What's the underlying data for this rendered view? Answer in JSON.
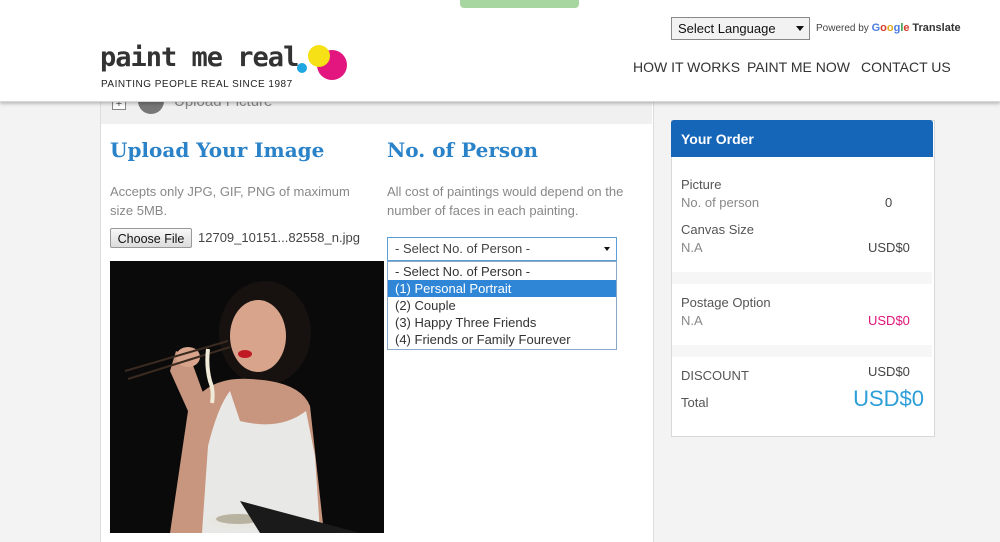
{
  "header": {
    "logo_text": "paint me real",
    "tagline": "PAINTING PEOPLE REAL SINCE 1987",
    "language_select": "Select Language",
    "powered_by": "Powered by",
    "google": "Google",
    "translate": "Translate",
    "nav": [
      "HOW IT WORKS",
      "PAINT ME NOW",
      "CONTACT US"
    ]
  },
  "step": {
    "plus": "+",
    "label": "Upload Picture"
  },
  "upload": {
    "title": "Upload Your Image",
    "desc": "Accepts only JPG, GIF, PNG of maximum size 5MB.",
    "choose_button": "Choose File",
    "file_name": "12709_10151...82558_n.jpg"
  },
  "persons": {
    "title": "No. of Person",
    "desc": "All cost of paintings would depend on the number of faces in each painting.",
    "select_value": "- Select No. of Person -",
    "options": [
      "- Select No. of Person -",
      "(1) Personal Portrait",
      "(2) Couple",
      "(3) Happy Three Friends",
      "(4) Friends or Family Fourever"
    ],
    "highlighted_index": 1
  },
  "order": {
    "title": "Your Order",
    "picture_label": "Picture",
    "person_label": "No. of person",
    "person_value": "0",
    "canvas_label": "Canvas Size",
    "canvas_value": "N.A",
    "canvas_price": "USD$0",
    "postage_label": "Postage Option",
    "postage_value": "N.A",
    "postage_price": "USD$0",
    "discount_label": "DISCOUNT",
    "discount_price": "USD$0",
    "total_label": "Total",
    "total_price": "USD$0"
  },
  "colors": {
    "brand_blue": "#1565b8",
    "heading_blue": "#2a82c8",
    "accent_pink": "#e0147a",
    "total_blue": "#2c9ed8"
  }
}
